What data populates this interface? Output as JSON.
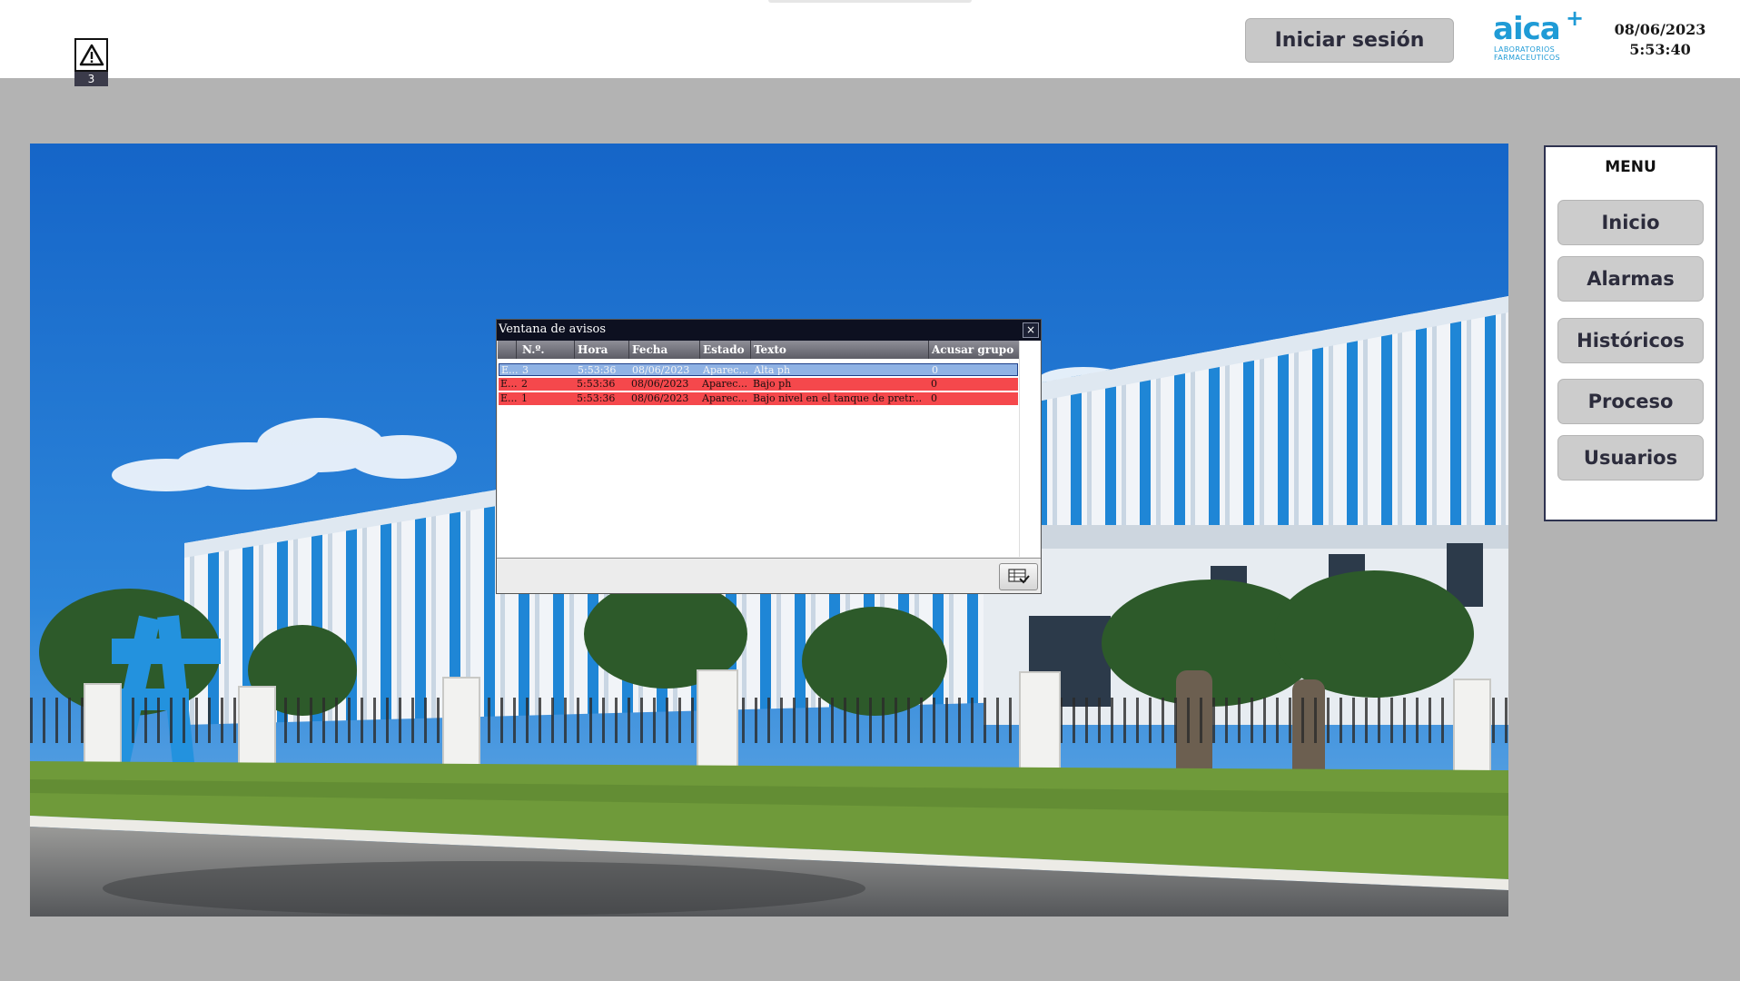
{
  "header": {
    "alarm_count": "3",
    "login_label": "Iniciar sesión",
    "logo": {
      "name": "aica",
      "subtitle_line1": "LABORATORIOS",
      "subtitle_line2": "FARMACEUTICOS"
    },
    "date": "08/06/2023",
    "time": "5:53:40"
  },
  "menu": {
    "title": "MENU",
    "items": [
      {
        "label": "Inicio"
      },
      {
        "label": "Alarmas"
      },
      {
        "label": "Históricos"
      },
      {
        "label": "Proceso"
      },
      {
        "label": "Usuarios"
      }
    ]
  },
  "alarm_window": {
    "title": "Ventana de avisos",
    "close_label": "×",
    "columns": [
      "N.º.",
      "Hora",
      "Fecha",
      "Estado",
      "Texto",
      "Acusar grupo"
    ],
    "rows": [
      {
        "clase": "E...",
        "numero": "3",
        "hora": "5:53:36",
        "fecha": "08/06/2023",
        "estado": "Aparec...",
        "texto": "Alta ph",
        "acusar_grupo": "0",
        "selected": true
      },
      {
        "clase": "E...",
        "numero": "2",
        "hora": "5:53:36",
        "fecha": "08/06/2023",
        "estado": "Aparec...",
        "texto": "Bajo ph",
        "acusar_grupo": "0",
        "selected": false
      },
      {
        "clase": "E...",
        "numero": "1",
        "hora": "5:53:36",
        "fecha": "08/06/2023",
        "estado": "Aparec...",
        "texto": "Bajo nivel en el tanque de pretr...",
        "acusar_grupo": "0",
        "selected": false
      }
    ]
  },
  "colors": {
    "header_bg": "#ffffff",
    "page_bg": "#b3b3b3",
    "alarm_row": "#f5484c",
    "selected_row": "#8fb2e4",
    "brand": "#1f9bd6"
  },
  "icons": {
    "alarm_indicator": "warning-triangle-icon",
    "acknowledge": "acknowledge-list-icon"
  }
}
